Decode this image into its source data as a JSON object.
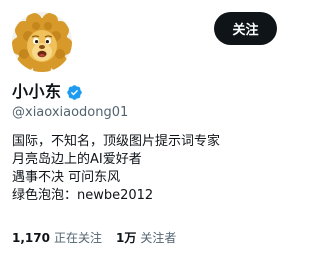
{
  "profile": {
    "display_name": "小小东",
    "handle": "@xiaoxiaodong01",
    "follow_label": "关注",
    "verified_icon": "verified-badge-icon",
    "accent_color": "#1d9bf0",
    "bio_lines": [
      "国际，不知名，顶级图片提示词专家",
      "月亮岛边上的AI爱好者",
      "遇事不决 可问东风",
      "绿色泡泡：newbe2012"
    ],
    "stats": [
      {
        "value": "1,170",
        "label": "正在关注"
      },
      {
        "value": "1万",
        "label": "关注者"
      }
    ]
  }
}
